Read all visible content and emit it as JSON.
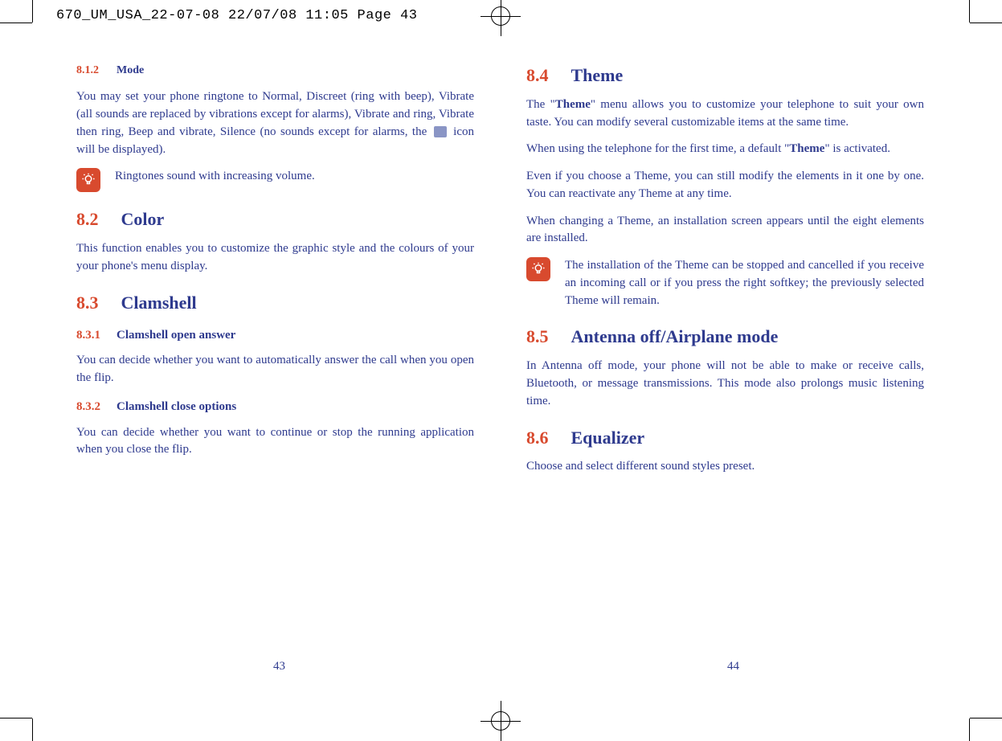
{
  "print_header": "670_UM_USA_22-07-08  22/07/08  11:05  Page 43",
  "left_column": {
    "s812": {
      "num": "8.1.2",
      "title": "Mode",
      "para1_a": "You may set your phone ringtone to Normal, Discreet (ring with beep), Vibrate (all sounds are replaced by vibrations except for alarms), Vibrate and ring, Vibrate then ring, Beep and vibrate, Silence (no sounds except for alarms, the ",
      "para1_b": " icon will be displayed).",
      "note": "Ringtones sound with increasing volume."
    },
    "s82": {
      "num": "8.2",
      "title": "Color",
      "para": "This function enables you to customize the graphic style and the colours of your your phone's menu display."
    },
    "s83": {
      "num": "8.3",
      "title": "Clamshell"
    },
    "s831": {
      "num": "8.3.1",
      "title": "Clamshell open answer",
      "para": "You can decide whether you want to automatically answer the call when you open the flip."
    },
    "s832": {
      "num": "8.3.2",
      "title": "Clamshell close options",
      "para": "You can decide whether you want to continue or stop the running application when you close the flip."
    },
    "page_num": "43"
  },
  "right_column": {
    "s84": {
      "num": "8.4",
      "title": "Theme",
      "para1_a": "The \"",
      "para1_bold1": "Theme",
      "para1_b": "\" menu allows you to customize your telephone to suit your own taste. You can modify several customizable items at the same time.",
      "para2_a": "When using the telephone for the first time, a default \"",
      "para2_bold": "Theme",
      "para2_b": "\" is activated.",
      "para3": "Even if you choose a Theme, you can still modify the elements in it one by one. You can reactivate any Theme at any time.",
      "para4": "When changing a Theme, an installation screen appears until the eight elements are installed.",
      "note": "The installation of the Theme can be stopped and cancelled if you receive an incoming call or if you press the right softkey; the previously selected Theme will remain."
    },
    "s85": {
      "num": "8.5",
      "title": "Antenna off/Airplane mode",
      "para": "In Antenna off mode, your phone will not be able to make or receive calls, Bluetooth, or message transmissions. This mode also prolongs music listening time."
    },
    "s86": {
      "num": "8.6",
      "title": "Equalizer",
      "para": "Choose and select different sound styles preset."
    },
    "page_num": "44"
  }
}
